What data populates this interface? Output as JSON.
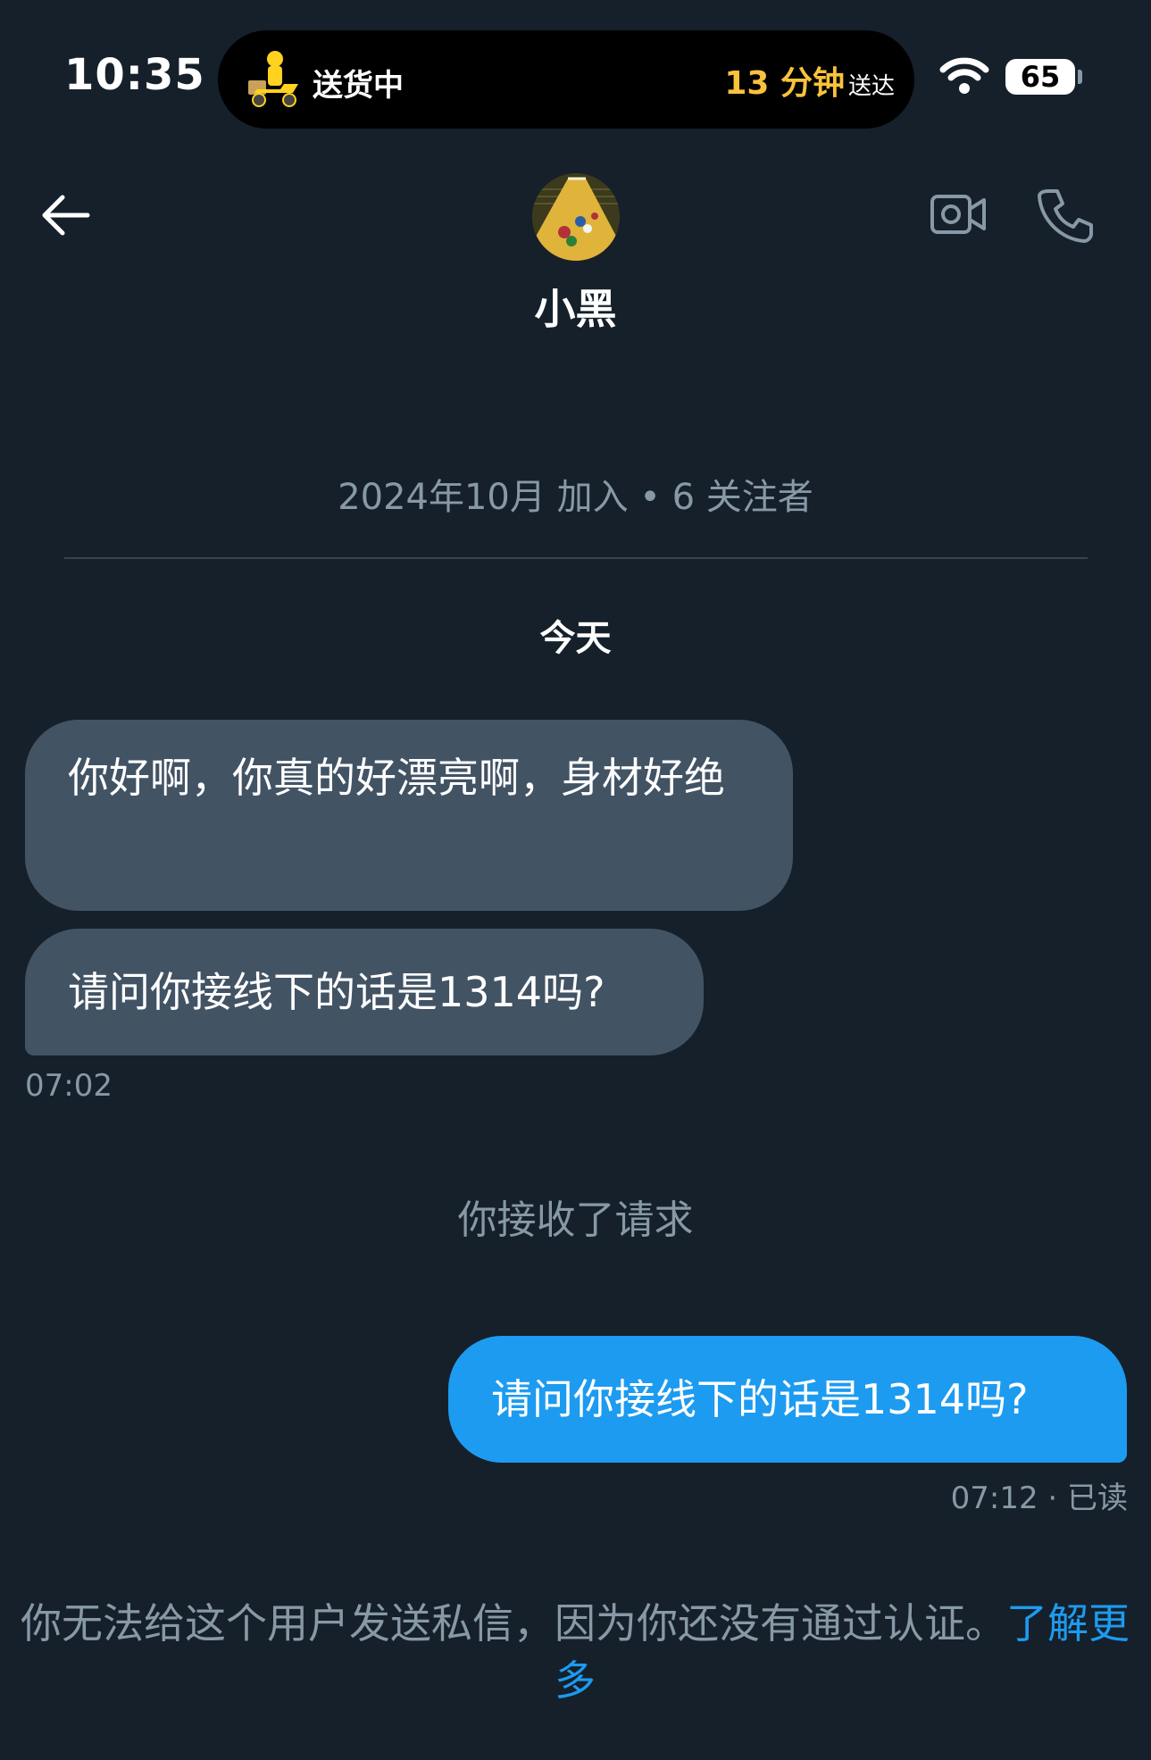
{
  "status_bar": {
    "time": "10:35",
    "delivery_label": "送货中",
    "eta_minutes": "13 分钟",
    "eta_suffix": "送达",
    "battery": "65"
  },
  "header": {
    "contact_name": "小黑"
  },
  "profile_info": {
    "joined_text": "2024年10月 加入 • 6 关注者"
  },
  "conversation": {
    "day_label": "今天",
    "messages": [
      {
        "direction": "incoming",
        "text": "你好啊，你真的好漂亮啊，身材好绝"
      },
      {
        "direction": "incoming",
        "text": "请问你接线下的话是1314吗?"
      },
      {
        "direction": "outgoing",
        "text": "请问你接线下的话是1314吗?"
      }
    ],
    "incoming_time": "07:02",
    "system_event": "你接收了请求",
    "outgoing_meta": "07:12 · 已读"
  },
  "footer_notice": {
    "text": "你无法给这个用户发送私信，因为你还没有通过认证。",
    "link_text": "了解更多"
  },
  "colors": {
    "background": "#15202b",
    "incoming_bubble": "#425364",
    "outgoing_bubble": "#1d9bf0",
    "muted_text": "#8899a6",
    "eta_accent": "#f9c23c"
  }
}
